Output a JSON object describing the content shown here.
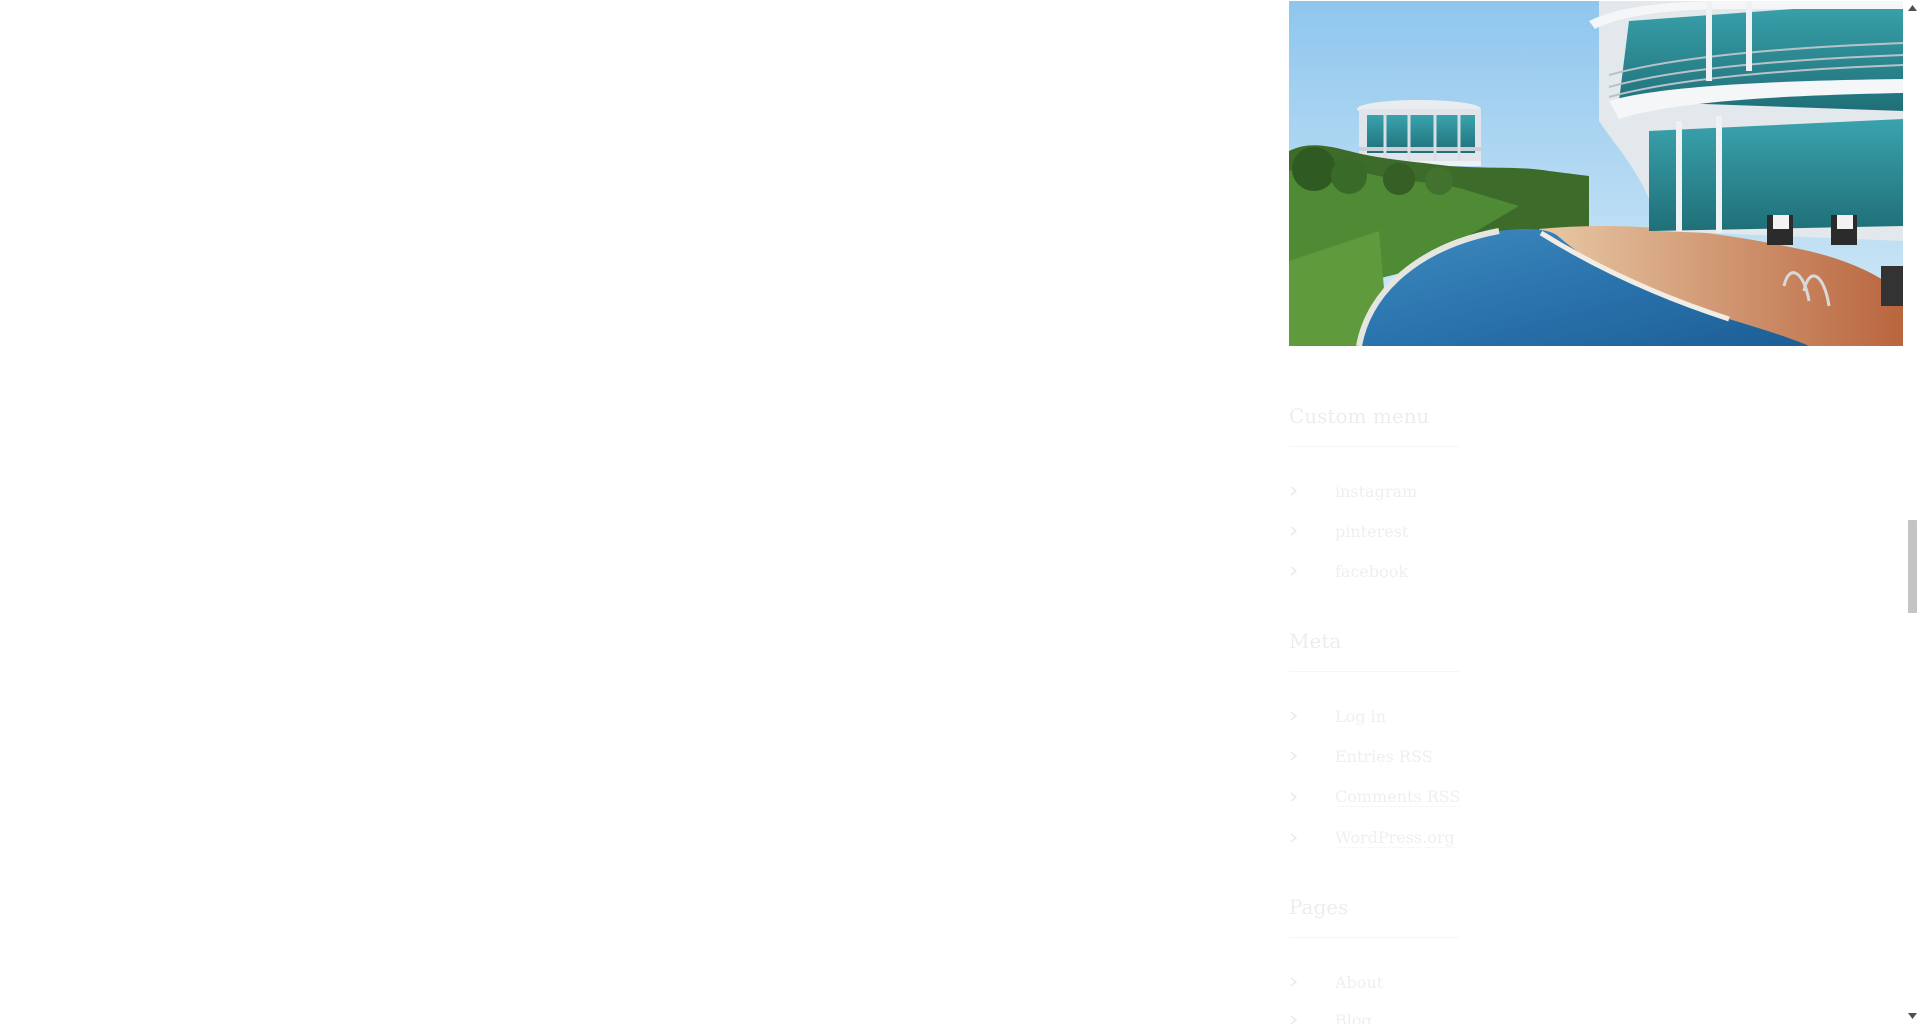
{
  "sidebar": {
    "featured_image": {
      "description": "Modern round building with infinity pool and garden"
    },
    "widgets": [
      {
        "title": "Custom menu",
        "items": [
          {
            "label": "instagram"
          },
          {
            "label": "pinterest"
          },
          {
            "label": "facebook"
          }
        ]
      },
      {
        "title": "Meta",
        "items": [
          {
            "label": "Log in"
          },
          {
            "label": "Entries RSS"
          },
          {
            "label": "Comments RSS"
          },
          {
            "label": "WordPress.org"
          }
        ]
      },
      {
        "title": "Pages",
        "items": [
          {
            "label": "About"
          },
          {
            "label": "Blog"
          }
        ]
      }
    ]
  },
  "scrollbar": {
    "position_fraction": 0.55
  },
  "colors": {
    "background": "#ffffff",
    "faded_text": "#efefef",
    "scroll_thumb": "#c4c4c4"
  }
}
